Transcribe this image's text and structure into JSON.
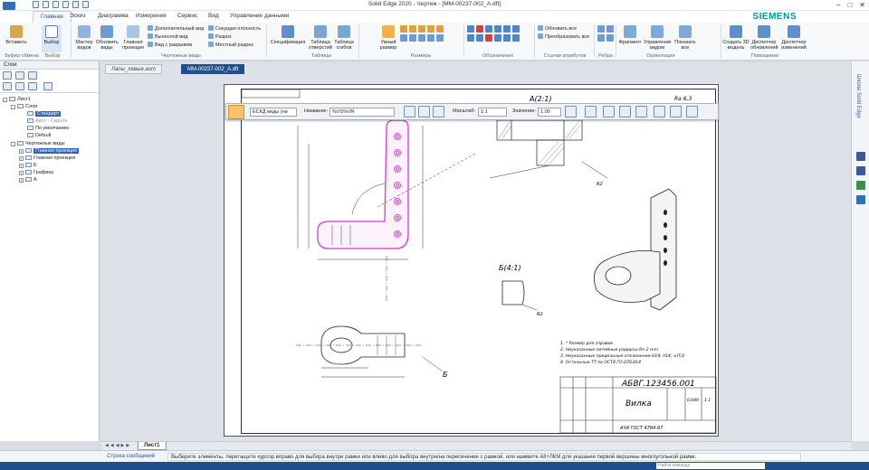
{
  "app": {
    "title": "Solid Edge 2020 - Чертеж - [MM-00237-002_A.dft]",
    "brand": "SIEMENS"
  },
  "tabs": [
    "Главная",
    "Эскиз",
    "Диаграмма",
    "Измерения",
    "Сервис",
    "Вид",
    "Управление данными"
  ],
  "ribbon": {
    "buttons": {
      "paste": "Вставить",
      "select": "Выбор",
      "master_views": "Мастер видов",
      "update_views": "Обновить виды",
      "main_projection": "Главная проекция",
      "spec": "Спецификация",
      "hole_table": "Таблица отверстий",
      "bend_table": "Таблица сгибов",
      "smart_dim": "Умный размер",
      "update_all": "Обновить все",
      "convert_all": "Преобразовать все",
      "fragment": "Фрагмент",
      "view_mgmt": "Управление видом",
      "show_all": "Показать все",
      "create_3d": "Создать 3D модель",
      "update_mgr": "Диспетчер обновлений",
      "change_mgr": "Диспетчер изменений"
    },
    "small": {
      "aux_view": "Дополнительный вид",
      "detail_view": "Выносной вид",
      "broken_view": "Вид с разрывом",
      "cutting_plane": "Секущая плоскость",
      "section": "Разрез",
      "local_section": "Местный разрез"
    },
    "groups": [
      "Буфер обмена",
      "Выбор",
      "Чертежные виды",
      "Таблицы",
      "Размеры",
      "Обозначения",
      "Ссылки атрибутов",
      "Ребра",
      "Ориентация",
      "Помощники"
    ]
  },
  "left_panel": {
    "header": "Слои",
    "tree": [
      {
        "label": "Лист1",
        "level": 0
      },
      {
        "label": "Слои",
        "level": 1
      },
      {
        "label": "Стандарт",
        "level": 2,
        "selected": true
      },
      {
        "label": "Авто - Скрыть",
        "level": 2,
        "muted": true
      },
      {
        "label": "По умолчанию",
        "level": 2
      },
      {
        "label": "Default",
        "level": 2
      },
      {
        "label": "Чертежные виды",
        "level": 1
      },
      {
        "label": "Главная проекция",
        "level": 2,
        "selected": true
      },
      {
        "label": "Главная проекция",
        "level": 2
      },
      {
        "label": "Б",
        "level": 2
      },
      {
        "label": "Графика",
        "level": 2
      },
      {
        "label": "А",
        "level": 2
      }
    ]
  },
  "doc_tabs": [
    {
      "label": "Лапы_левые.asm",
      "active": false
    },
    {
      "label": "MM-00237-002_A.dft",
      "active": true
    }
  ],
  "command_bar": {
    "style_value": "ЕСКД виды (ни",
    "name_label": "Название:",
    "name_value": "%VS%VR",
    "scale_label": "Масштаб:",
    "scale_value": "1:1",
    "value_label": "Значение:",
    "value_value": "1.00"
  },
  "drawing": {
    "detail_a": "A(2:1)",
    "detail_b": "Б(4:1)",
    "label_b": "Б",
    "roughness": "Ra 6,3",
    "notes": [
      "1. * Размер для справок",
      "2. Неуказанные литейные радиусы Rn 2 mm",
      "3. Неуказанные предельные отклонения H14, h14, ±IT/2",
      "4. Остальные ТТ по ОСТ4 ГО.070.014"
    ],
    "title_block": {
      "code": "АБВГ.123456.001",
      "name": "Вилка",
      "material": "АЧ4 ГОСТ 4784-97",
      "mass": "0,049",
      "scale": "1:1"
    }
  },
  "sheet_tab": "Лист1",
  "status": {
    "label": "Строка сообщений",
    "message": "Выберите элементы, перетащите курсор вправо для выбора внутри рамки или влево для выбора внутри/на пересечении с рамкой, или нажмите Alt+ЛКМ для указания первой вершины многоугольной рамки."
  },
  "command_finder": "Найти команду",
  "right_strip_label": "Школа Solid Edge"
}
